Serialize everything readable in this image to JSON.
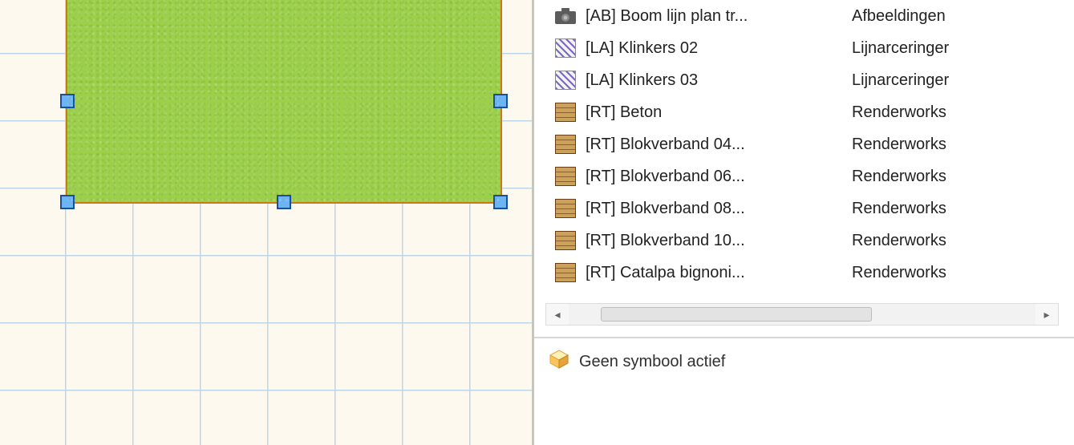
{
  "canvas": {
    "has_selected_rectangle": true
  },
  "resource_list": {
    "items": [
      {
        "icon": "camera",
        "name": "[AB] Boom lijn plan tr...",
        "type": "Afbeeldingen"
      },
      {
        "icon": "hatch",
        "name": "[LA] Klinkers 02",
        "type": "Lijnarceringer"
      },
      {
        "icon": "hatch",
        "name": "[LA] Klinkers 03",
        "type": "Lijnarceringer"
      },
      {
        "icon": "texture",
        "name": "[RT] Beton",
        "type": "Renderworks "
      },
      {
        "icon": "texture",
        "name": "[RT] Blokverband 04...",
        "type": "Renderworks "
      },
      {
        "icon": "texture",
        "name": "[RT] Blokverband 06...",
        "type": "Renderworks "
      },
      {
        "icon": "texture",
        "name": "[RT] Blokverband 08...",
        "type": "Renderworks "
      },
      {
        "icon": "texture",
        "name": "[RT] Blokverband 10...",
        "type": "Renderworks "
      },
      {
        "icon": "texture",
        "name": "[RT] Catalpa bignoni...",
        "type": "Renderworks "
      }
    ]
  },
  "status": {
    "text": "Geen symbool actief"
  }
}
